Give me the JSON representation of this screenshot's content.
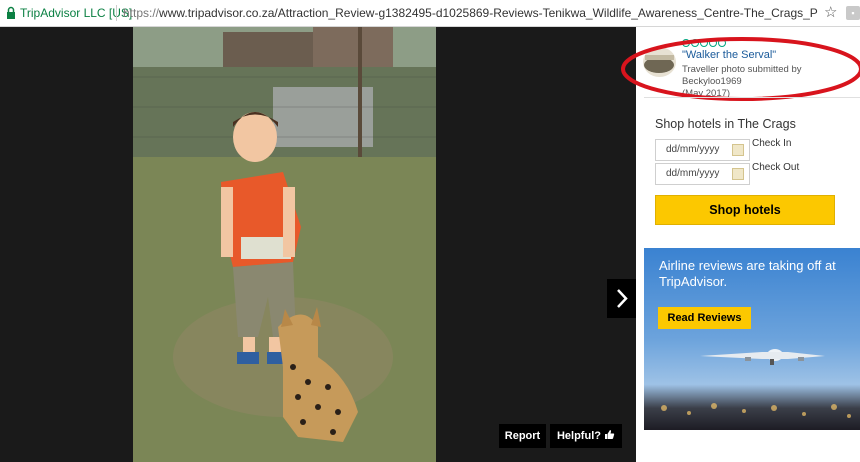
{
  "address_bar": {
    "site_identity": "TripAdvisor LLC [US]",
    "url_scheme": "https://",
    "url_rest": "www.tripadvisor.co.za/Attraction_Review-g1382495-d1025869-Reviews-Tenikwa_Wildlife_Awareness_Centre-The_Crags_Plettenberg_Bay_Western_",
    "lock_icon": "lock-icon",
    "bookmark_icon": "star-icon"
  },
  "viewer": {
    "next_icon": "chevron-right-icon",
    "report_label": "Report",
    "helpful_label": "Helpful?",
    "helpful_icon": "thumbs-up-icon"
  },
  "photo_info": {
    "rating_bubbles": 5,
    "title": "\"Walker the Serval\"",
    "submitted_by": "Traveller photo submitted by Beckyloo1969",
    "date": "(May 2017)",
    "highlight_color": "#d8141d"
  },
  "hotel_search": {
    "title": "Shop hotels in The Crags",
    "check_in_placeholder": "dd/mm/yyyy",
    "check_out_placeholder": "dd/mm/yyyy",
    "check_in_label": "Check In",
    "check_out_label": "Check Out",
    "button_label": "Shop hotels",
    "button_color": "#fcc800"
  },
  "ad": {
    "headline": "Airline reviews are taking off at TripAdvisor.",
    "button_label": "Read Reviews"
  }
}
